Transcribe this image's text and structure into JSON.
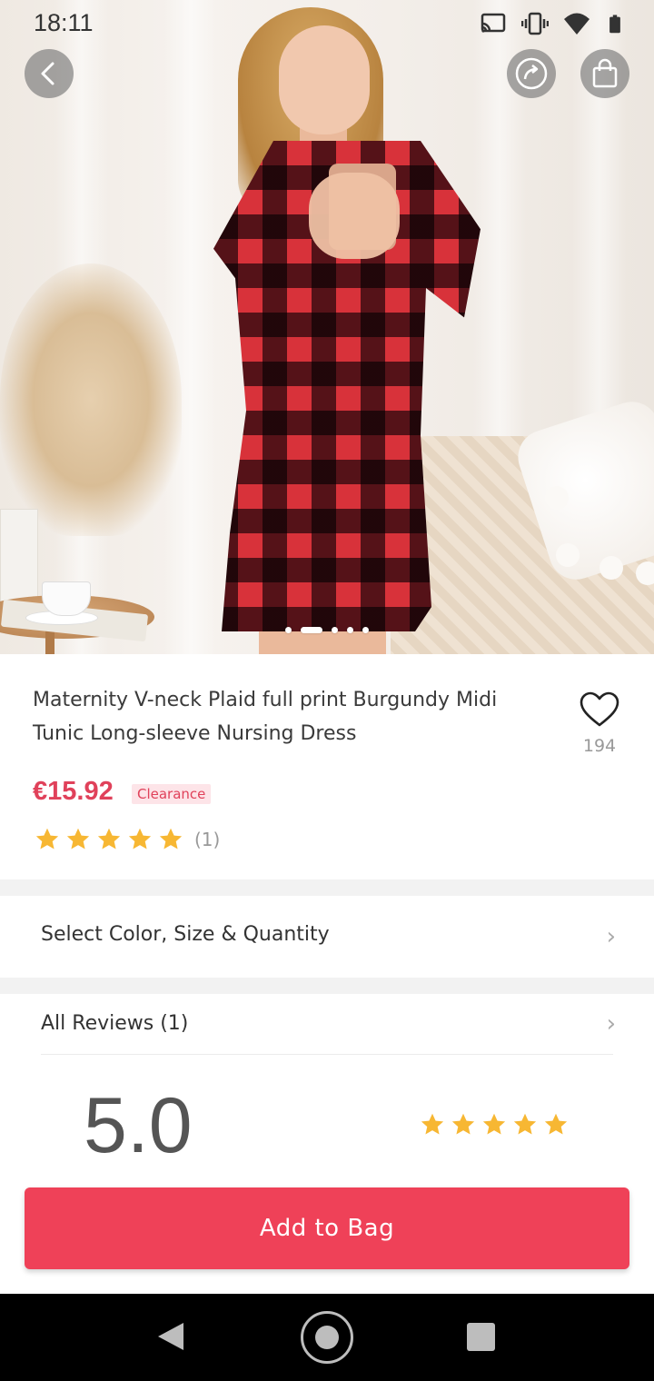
{
  "status_bar": {
    "time": "18:11",
    "icons": [
      "cast-icon",
      "vibrate-icon",
      "wifi-icon",
      "battery-icon"
    ]
  },
  "header": {
    "back_icon": "chevron-left-icon",
    "share_icon": "share-icon",
    "bag_icon": "shopping-bag-icon"
  },
  "gallery": {
    "page_count": 5,
    "active_index": 1
  },
  "product": {
    "title": "Maternity V-neck Plaid full print Burgundy Midi Tunic Long-sleeve Nursing Dress",
    "favorite_count": "194",
    "price": "€15.92",
    "badge": "Clearance",
    "rating_stars": 5,
    "rating_count": "(1)"
  },
  "options": {
    "select_label": "Select Color, Size & Quantity"
  },
  "reviews": {
    "label": "All Reviews (1)",
    "score": "5.0",
    "stars": 5
  },
  "actions": {
    "add_to_bag": "Add to Bag"
  },
  "colors": {
    "accent": "#ef4158",
    "price": "#e0415a",
    "star": "#f7b733"
  }
}
